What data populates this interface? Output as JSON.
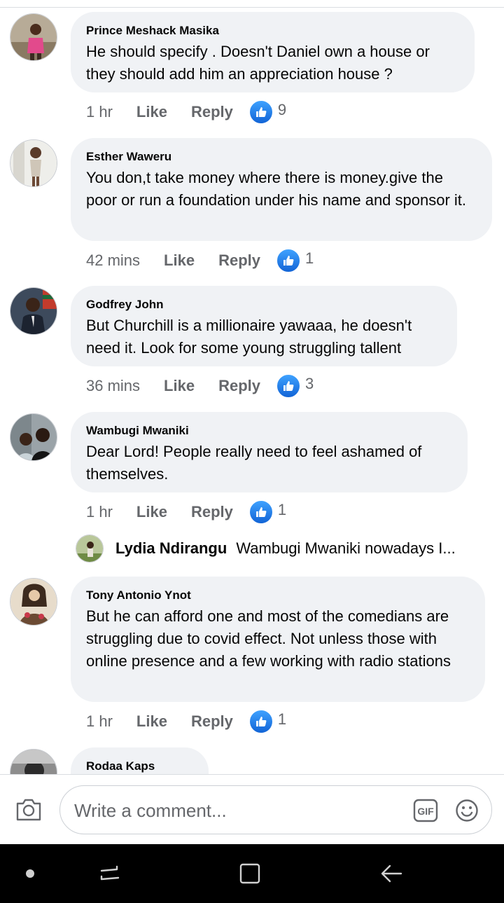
{
  "comments": [
    {
      "name": "Prince Meshack Masika",
      "text": "He should specify . Doesn't Daniel own a house or they should add him an appreciation house ?",
      "time": "1 hr",
      "like_label": "Like",
      "reply_label": "Reply",
      "reaction_count": "9"
    },
    {
      "name": "Esther Waweru",
      "text": "You don,t take money where there is money.give the poor or run a foundation under his name and sponsor it.",
      "time": "42 mins",
      "like_label": "Like",
      "reply_label": "Reply",
      "reaction_count": "1"
    },
    {
      "name": "Godfrey John",
      "text": "But Churchill is a millionaire yawaaa, he doesn't need it. Look for some young struggling tallent",
      "time": "36 mins",
      "like_label": "Like",
      "reply_label": "Reply",
      "reaction_count": "3"
    },
    {
      "name": "Wambugi Mwaniki",
      "text": "Dear Lord! People really need to feel ashamed of themselves.",
      "time": "1 hr",
      "like_label": "Like",
      "reply_label": "Reply",
      "reaction_count": "1"
    },
    {
      "name": "Tony Antonio Ynot",
      "text": "But he can afford one and most of the comedians are struggling due to covid effect. Not unless those with online presence and a few working with radio stations",
      "time": "1 hr",
      "like_label": "Like",
      "reply_label": "Reply",
      "reaction_count": "1"
    },
    {
      "name": "Rodaa Kaps"
    }
  ],
  "reply_preview": {
    "name": "Lydia Ndirangu",
    "text": "Wambugi Mwaniki nowadays I..."
  },
  "composer": {
    "placeholder": "Write a comment..."
  },
  "colors": {
    "bubble": "#f0f2f5",
    "meta_text": "#65676b",
    "like_blue": "#1877f2",
    "navbar": "#000000"
  },
  "icons": {
    "reaction": "thumbs-up-icon",
    "camera": "camera-icon",
    "gif": "gif-icon",
    "emoji": "emoji-icon",
    "nav_recents": "recents-icon",
    "nav_home": "home-icon",
    "nav_back": "back-icon"
  }
}
